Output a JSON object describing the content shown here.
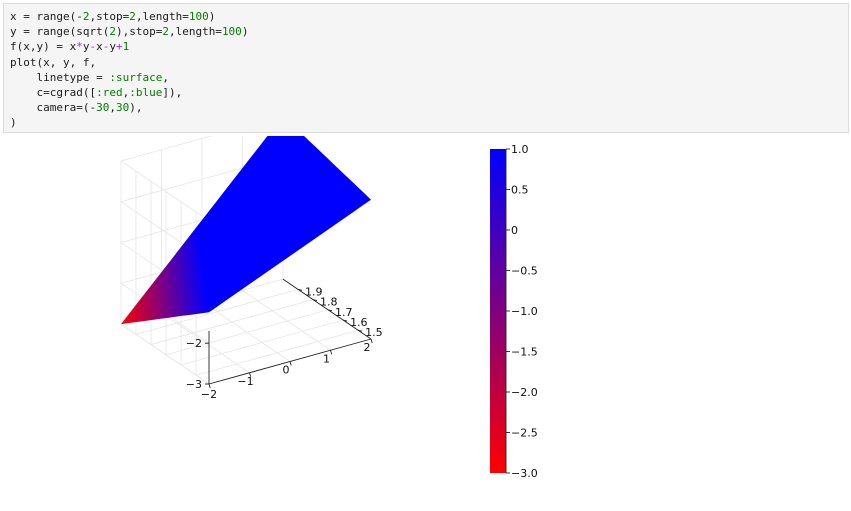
{
  "code_cell": {
    "lines": [
      [
        {
          "t": "x = range(-",
          "c": "#1c1c1c"
        },
        {
          "t": "2",
          "c": "#008000"
        },
        {
          "t": ",stop=",
          "c": "#1c1c1c"
        },
        {
          "t": "2",
          "c": "#008000"
        },
        {
          "t": ",length=",
          "c": "#1c1c1c"
        },
        {
          "t": "100",
          "c": "#008000"
        },
        {
          "t": ")",
          "c": "#1c1c1c"
        }
      ],
      [
        {
          "t": "y = range(sqrt(",
          "c": "#1c1c1c"
        },
        {
          "t": "2",
          "c": "#008000"
        },
        {
          "t": "),stop=",
          "c": "#1c1c1c"
        },
        {
          "t": "2",
          "c": "#008000"
        },
        {
          "t": ",length=",
          "c": "#1c1c1c"
        },
        {
          "t": "100",
          "c": "#008000"
        },
        {
          "t": ")",
          "c": "#1c1c1c"
        }
      ],
      [
        {
          "t": "f(x,y) = x",
          "c": "#1c1c1c"
        },
        {
          "t": "*",
          "c": "#aa22ff"
        },
        {
          "t": "y",
          "c": "#1c1c1c"
        },
        {
          "t": "-",
          "c": "#aa22ff"
        },
        {
          "t": "x",
          "c": "#1c1c1c"
        },
        {
          "t": "-",
          "c": "#aa22ff"
        },
        {
          "t": "y",
          "c": "#1c1c1c"
        },
        {
          "t": "+",
          "c": "#aa22ff"
        },
        {
          "t": "1",
          "c": "#008000"
        }
      ],
      [
        {
          "t": "plot(x, y, f,",
          "c": "#1c1c1c"
        }
      ],
      [
        {
          "t": "    linetype = ",
          "c": "#1c1c1c"
        },
        {
          "t": ":surface",
          "c": "#008000"
        },
        {
          "t": ",",
          "c": "#1c1c1c"
        }
      ],
      [
        {
          "t": "    c=cgrad([",
          "c": "#1c1c1c"
        },
        {
          "t": ":red",
          "c": "#008000"
        },
        {
          "t": ",",
          "c": "#1c1c1c"
        },
        {
          "t": ":blue",
          "c": "#008000"
        },
        {
          "t": "]),",
          "c": "#1c1c1c"
        }
      ],
      [
        {
          "t": "    camera=(-",
          "c": "#1c1c1c"
        },
        {
          "t": "30",
          "c": "#008000"
        },
        {
          "t": ",",
          "c": "#1c1c1c"
        },
        {
          "t": "30",
          "c": "#008000"
        },
        {
          "t": "),",
          "c": "#1c1c1c"
        }
      ],
      [
        {
          "t": ")",
          "c": "#1c1c1c"
        }
      ]
    ]
  },
  "chart_data": {
    "type": "surface",
    "function": "f(x,y) = x*y-x-y+1",
    "x_range": [
      -2,
      2
    ],
    "y_range": [
      1.4142,
      2
    ],
    "samples": 100,
    "camera": [
      -30,
      30
    ],
    "color_gradient": [
      "#ff0000",
      "#0000ff"
    ],
    "x_ticks": [
      "−2",
      "−1",
      "0",
      "1",
      "2"
    ],
    "y_ticks": [
      "1.5",
      "1.6",
      "1.7",
      "1.8",
      "1.9"
    ],
    "z_ticks": [
      "−3",
      "−2"
    ],
    "colorbar": {
      "range": [
        -3.0,
        1.0
      ],
      "ticks": [
        {
          "value": 1.0,
          "label": "1.0"
        },
        {
          "value": 0.5,
          "label": "0.5"
        },
        {
          "value": 0.0,
          "label": "0"
        },
        {
          "value": -0.5,
          "label": "−0.5"
        },
        {
          "value": -1.0,
          "label": "−1.0"
        },
        {
          "value": -1.5,
          "label": "−1.5"
        },
        {
          "value": -2.0,
          "label": "−2.0"
        },
        {
          "value": -2.5,
          "label": "−2.5"
        },
        {
          "value": -3.0,
          "label": "−3.0"
        }
      ]
    }
  }
}
